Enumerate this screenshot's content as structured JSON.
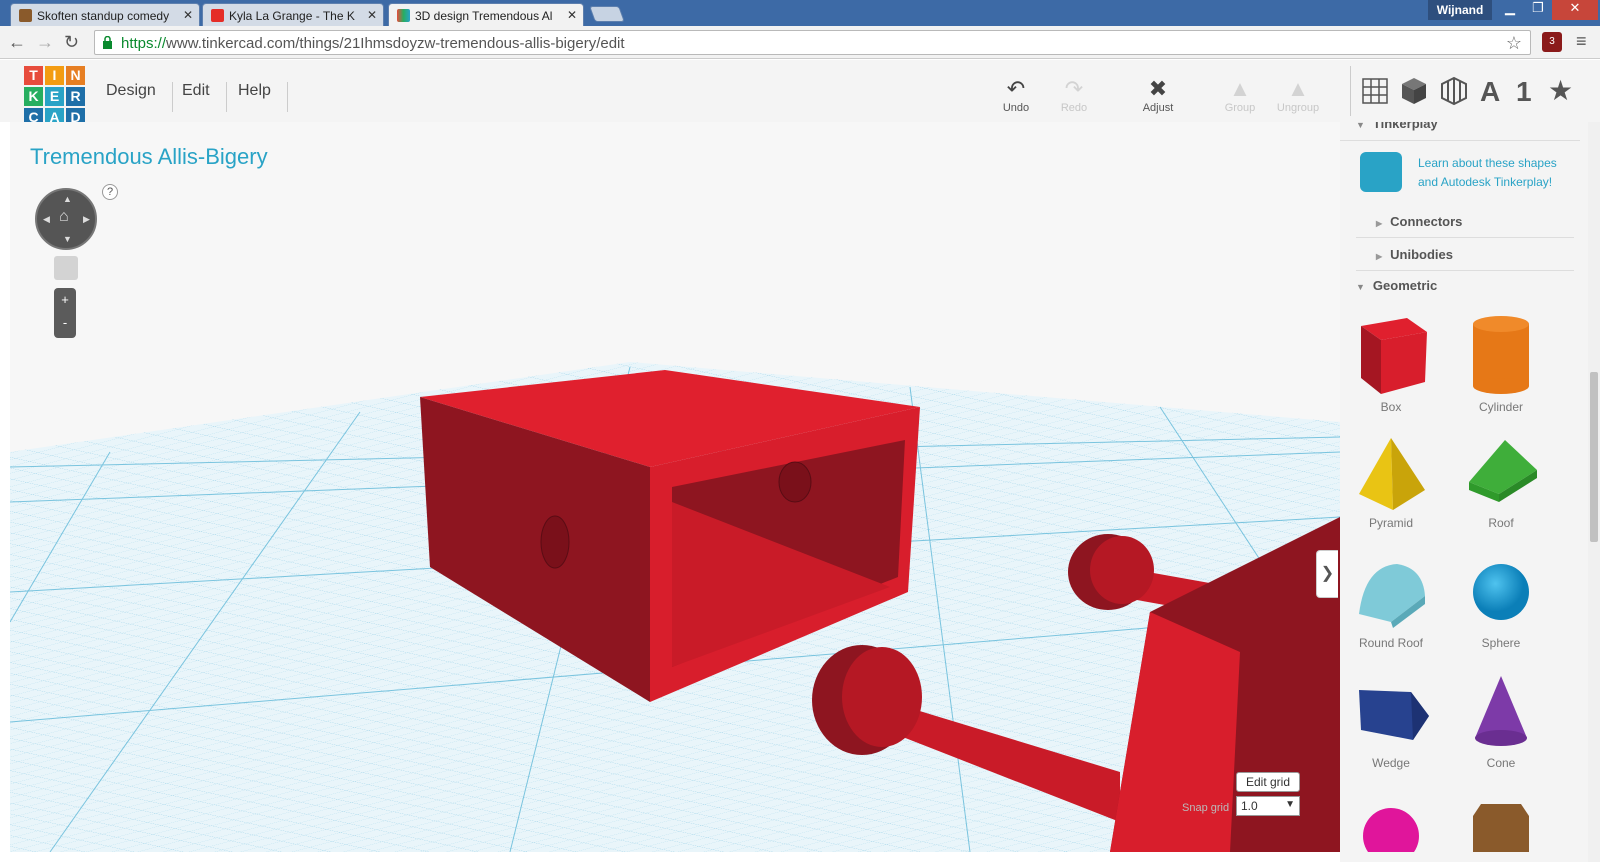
{
  "browser": {
    "tabs": [
      {
        "title": "Skoften standup comedy",
        "active": false
      },
      {
        "title": "Kyla La Grange - The K",
        "active": false
      },
      {
        "title": "3D design Tremendous Al",
        "active": true
      }
    ],
    "user": "Wijnand",
    "url_scheme": "https://",
    "url_rest": "www.tinkercad.com/things/21Ihmsdoyzw-tremendous-allis-bigery/edit",
    "extension_badge": "3"
  },
  "app": {
    "logo_letters": [
      "T",
      "I",
      "N",
      "K",
      "E",
      "R",
      "C",
      "A",
      "D"
    ],
    "menu": [
      "Design",
      "Edit",
      "Help"
    ],
    "tools": {
      "undo": "Undo",
      "redo": "Redo",
      "adjust": "Adjust",
      "group": "Group",
      "ungroup": "Ungroup"
    },
    "view_icons": [
      "grid-view-icon",
      "box-view-icon",
      "wireframe-view-icon",
      "text-icon",
      "number-icon",
      "favorite-star-icon"
    ],
    "view_text_a": "A",
    "view_text_1": "1"
  },
  "viewport": {
    "design_title": "Tremendous Allis-Bigery",
    "help": "?",
    "zoom_in": "+",
    "zoom_out": "-",
    "edit_grid": "Edit grid",
    "snap_label": "Snap grid",
    "snap_value": "1.0"
  },
  "panel": {
    "tinkerplay_title": "Tinkerplay",
    "tinkerplay_text": "Learn about these shapes and Autodesk Tinkerplay!",
    "connectors": "Connectors",
    "unibodies": "Unibodies",
    "geometric": "Geometric",
    "shapes": [
      "Box",
      "Cylinder",
      "Pyramid",
      "Roof",
      "Round Roof",
      "Sphere",
      "Wedge",
      "Cone"
    ]
  },
  "colors": {
    "brand_blue": "#29a3c6",
    "model_red": "#d81e2c",
    "grid_blue": "#5fb8d8"
  }
}
